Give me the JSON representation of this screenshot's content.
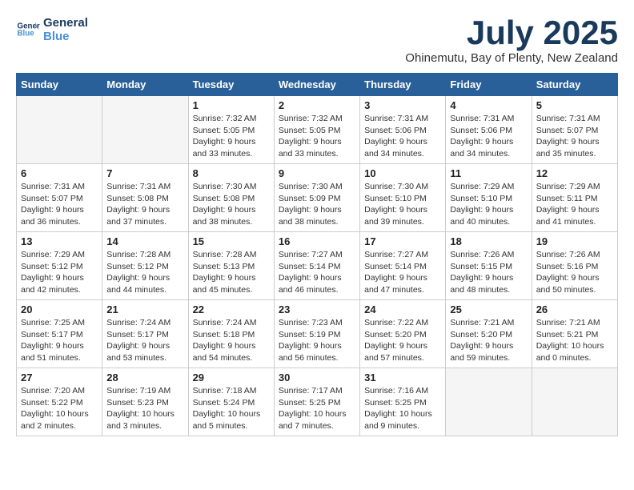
{
  "logo": {
    "line1": "General",
    "line2": "Blue"
  },
  "title": "July 2025",
  "location": "Ohinemutu, Bay of Plenty, New Zealand",
  "headers": [
    "Sunday",
    "Monday",
    "Tuesday",
    "Wednesday",
    "Thursday",
    "Friday",
    "Saturday"
  ],
  "weeks": [
    [
      {
        "day": "",
        "info": ""
      },
      {
        "day": "",
        "info": ""
      },
      {
        "day": "1",
        "info": "Sunrise: 7:32 AM\nSunset: 5:05 PM\nDaylight: 9 hours and 33 minutes."
      },
      {
        "day": "2",
        "info": "Sunrise: 7:32 AM\nSunset: 5:05 PM\nDaylight: 9 hours and 33 minutes."
      },
      {
        "day": "3",
        "info": "Sunrise: 7:31 AM\nSunset: 5:06 PM\nDaylight: 9 hours and 34 minutes."
      },
      {
        "day": "4",
        "info": "Sunrise: 7:31 AM\nSunset: 5:06 PM\nDaylight: 9 hours and 34 minutes."
      },
      {
        "day": "5",
        "info": "Sunrise: 7:31 AM\nSunset: 5:07 PM\nDaylight: 9 hours and 35 minutes."
      }
    ],
    [
      {
        "day": "6",
        "info": "Sunrise: 7:31 AM\nSunset: 5:07 PM\nDaylight: 9 hours and 36 minutes."
      },
      {
        "day": "7",
        "info": "Sunrise: 7:31 AM\nSunset: 5:08 PM\nDaylight: 9 hours and 37 minutes."
      },
      {
        "day": "8",
        "info": "Sunrise: 7:30 AM\nSunset: 5:08 PM\nDaylight: 9 hours and 38 minutes."
      },
      {
        "day": "9",
        "info": "Sunrise: 7:30 AM\nSunset: 5:09 PM\nDaylight: 9 hours and 38 minutes."
      },
      {
        "day": "10",
        "info": "Sunrise: 7:30 AM\nSunset: 5:10 PM\nDaylight: 9 hours and 39 minutes."
      },
      {
        "day": "11",
        "info": "Sunrise: 7:29 AM\nSunset: 5:10 PM\nDaylight: 9 hours and 40 minutes."
      },
      {
        "day": "12",
        "info": "Sunrise: 7:29 AM\nSunset: 5:11 PM\nDaylight: 9 hours and 41 minutes."
      }
    ],
    [
      {
        "day": "13",
        "info": "Sunrise: 7:29 AM\nSunset: 5:12 PM\nDaylight: 9 hours and 42 minutes."
      },
      {
        "day": "14",
        "info": "Sunrise: 7:28 AM\nSunset: 5:12 PM\nDaylight: 9 hours and 44 minutes."
      },
      {
        "day": "15",
        "info": "Sunrise: 7:28 AM\nSunset: 5:13 PM\nDaylight: 9 hours and 45 minutes."
      },
      {
        "day": "16",
        "info": "Sunrise: 7:27 AM\nSunset: 5:14 PM\nDaylight: 9 hours and 46 minutes."
      },
      {
        "day": "17",
        "info": "Sunrise: 7:27 AM\nSunset: 5:14 PM\nDaylight: 9 hours and 47 minutes."
      },
      {
        "day": "18",
        "info": "Sunrise: 7:26 AM\nSunset: 5:15 PM\nDaylight: 9 hours and 48 minutes."
      },
      {
        "day": "19",
        "info": "Sunrise: 7:26 AM\nSunset: 5:16 PM\nDaylight: 9 hours and 50 minutes."
      }
    ],
    [
      {
        "day": "20",
        "info": "Sunrise: 7:25 AM\nSunset: 5:17 PM\nDaylight: 9 hours and 51 minutes."
      },
      {
        "day": "21",
        "info": "Sunrise: 7:24 AM\nSunset: 5:17 PM\nDaylight: 9 hours and 53 minutes."
      },
      {
        "day": "22",
        "info": "Sunrise: 7:24 AM\nSunset: 5:18 PM\nDaylight: 9 hours and 54 minutes."
      },
      {
        "day": "23",
        "info": "Sunrise: 7:23 AM\nSunset: 5:19 PM\nDaylight: 9 hours and 56 minutes."
      },
      {
        "day": "24",
        "info": "Sunrise: 7:22 AM\nSunset: 5:20 PM\nDaylight: 9 hours and 57 minutes."
      },
      {
        "day": "25",
        "info": "Sunrise: 7:21 AM\nSunset: 5:20 PM\nDaylight: 9 hours and 59 minutes."
      },
      {
        "day": "26",
        "info": "Sunrise: 7:21 AM\nSunset: 5:21 PM\nDaylight: 10 hours and 0 minutes."
      }
    ],
    [
      {
        "day": "27",
        "info": "Sunrise: 7:20 AM\nSunset: 5:22 PM\nDaylight: 10 hours and 2 minutes."
      },
      {
        "day": "28",
        "info": "Sunrise: 7:19 AM\nSunset: 5:23 PM\nDaylight: 10 hours and 3 minutes."
      },
      {
        "day": "29",
        "info": "Sunrise: 7:18 AM\nSunset: 5:24 PM\nDaylight: 10 hours and 5 minutes."
      },
      {
        "day": "30",
        "info": "Sunrise: 7:17 AM\nSunset: 5:25 PM\nDaylight: 10 hours and 7 minutes."
      },
      {
        "day": "31",
        "info": "Sunrise: 7:16 AM\nSunset: 5:25 PM\nDaylight: 10 hours and 9 minutes."
      },
      {
        "day": "",
        "info": ""
      },
      {
        "day": "",
        "info": ""
      }
    ]
  ]
}
